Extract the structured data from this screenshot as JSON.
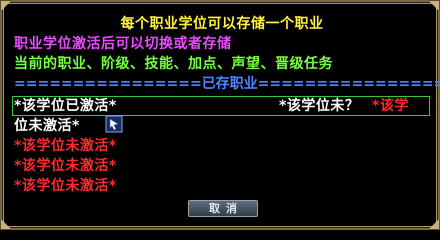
{
  "dialog": {
    "title": "每个职业学位可以存储一个职业",
    "line1": "职业学位激活后可以切换或者存储",
    "line2": "当前的职业、阶级、技能、加点、声望、晋级任务",
    "separator": "================已存职业================"
  },
  "slots": [
    {
      "text": "*该学位已激活*"
    },
    {
      "text": "*该学位未？"
    },
    {
      "text": "*该学"
    },
    {
      "text": "位未激活*"
    },
    {
      "text": "*该学位未激活*"
    },
    {
      "text": "*该学位未激活*"
    },
    {
      "text": "*该学位未激活*"
    }
  ],
  "buttons": {
    "cancel_label": "取消"
  },
  "icons": {
    "cursor": "cursor-icon"
  },
  "colors": {
    "title": "#fff23a",
    "line1": "#e94bff",
    "line2": "#76ff3f",
    "separator": "#4f86ff",
    "inactive": "#ff2a2a",
    "active_border": "#39c742"
  }
}
